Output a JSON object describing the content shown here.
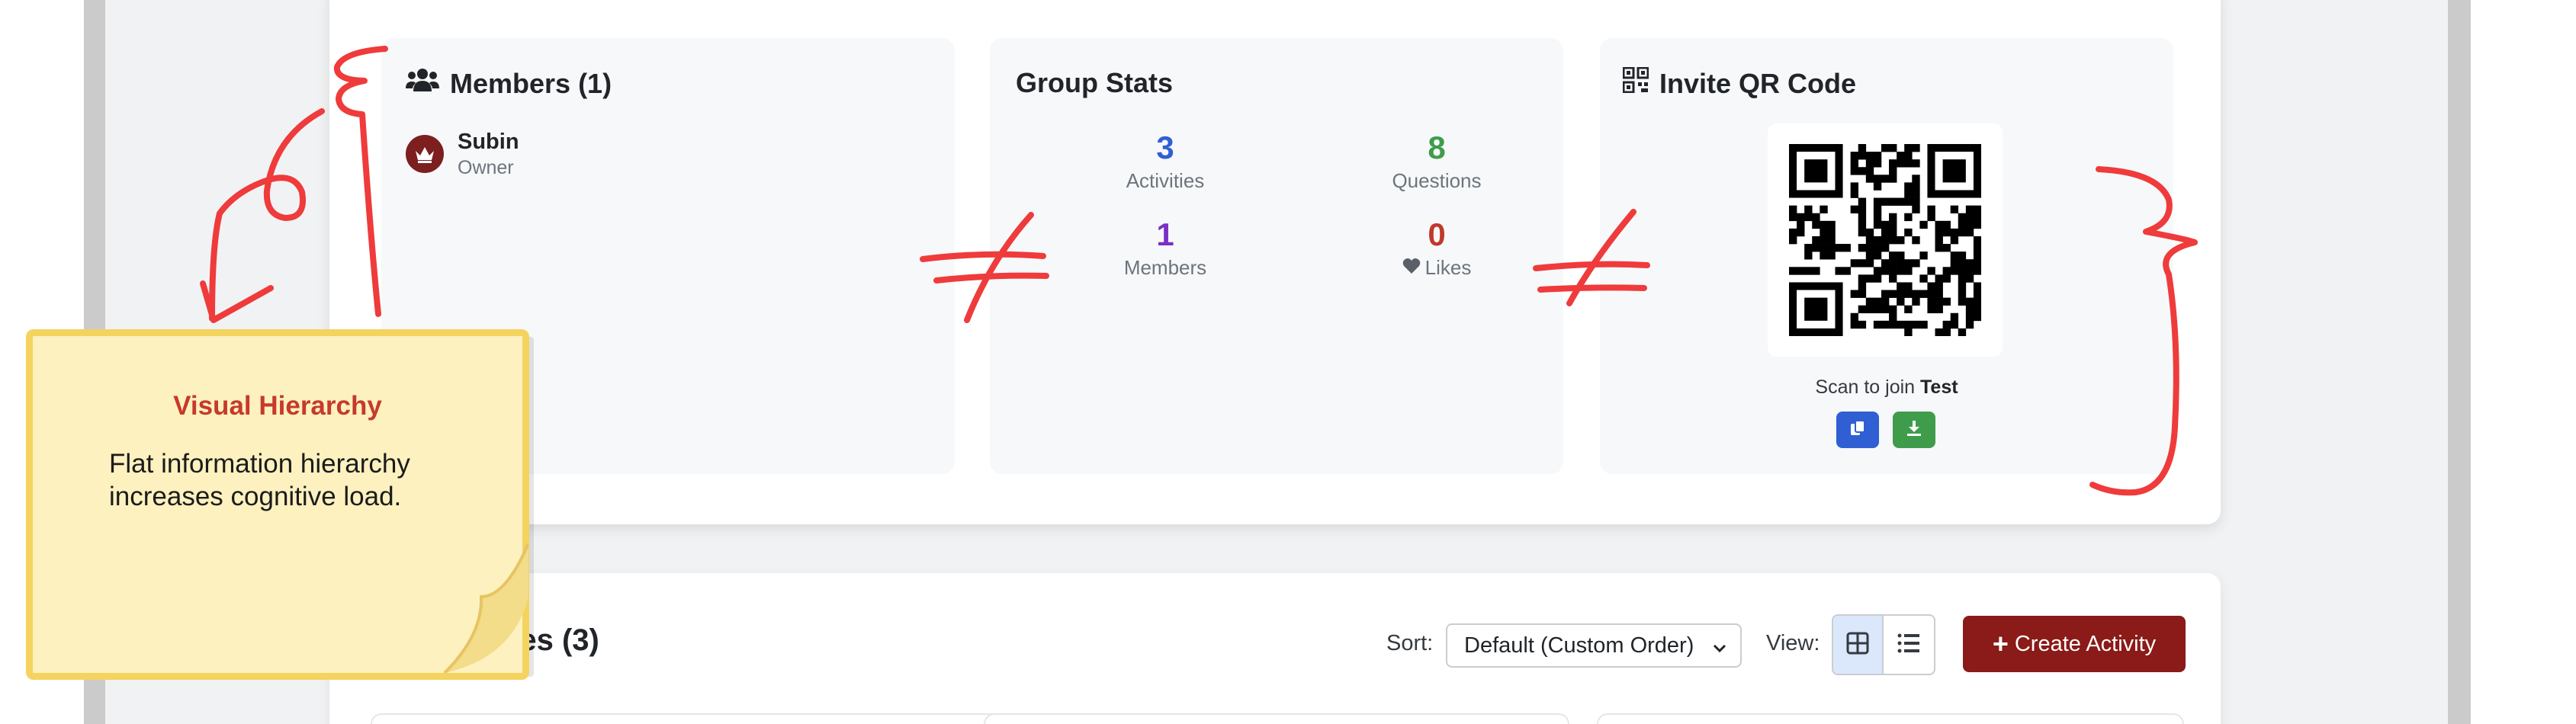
{
  "members_panel": {
    "title": "Members (1)",
    "members": [
      {
        "name": "Subin",
        "role": "Owner"
      }
    ]
  },
  "stats_panel": {
    "title": "Group Stats",
    "stats": [
      {
        "value": "3",
        "label": "Activities",
        "color": "#2f5fd3"
      },
      {
        "value": "8",
        "label": "Questions",
        "color": "#3f9c4b"
      },
      {
        "value": "1",
        "label": "Members",
        "color": "#7b2fc4"
      },
      {
        "value": "0",
        "label": "Likes",
        "color": "#c0392b"
      }
    ]
  },
  "qr_panel": {
    "title": "Invite QR Code",
    "caption_prefix": "Scan to join",
    "group_name": "Test"
  },
  "activities": {
    "title": "Activities (3)",
    "sort_label": "Sort:",
    "sort_value": "Default (Custom Order)",
    "view_label": "View:",
    "create_label": "Create Activity"
  },
  "sticky_note": {
    "title": "Visual Hierarchy",
    "body": "Flat information hierarchy increases cognitive load."
  },
  "colors": {
    "accent_red": "#8a1b18",
    "annotation_red": "#ef3b3b",
    "sticky_fill": "#fdf1bf",
    "sticky_border": "#f4d35e"
  }
}
